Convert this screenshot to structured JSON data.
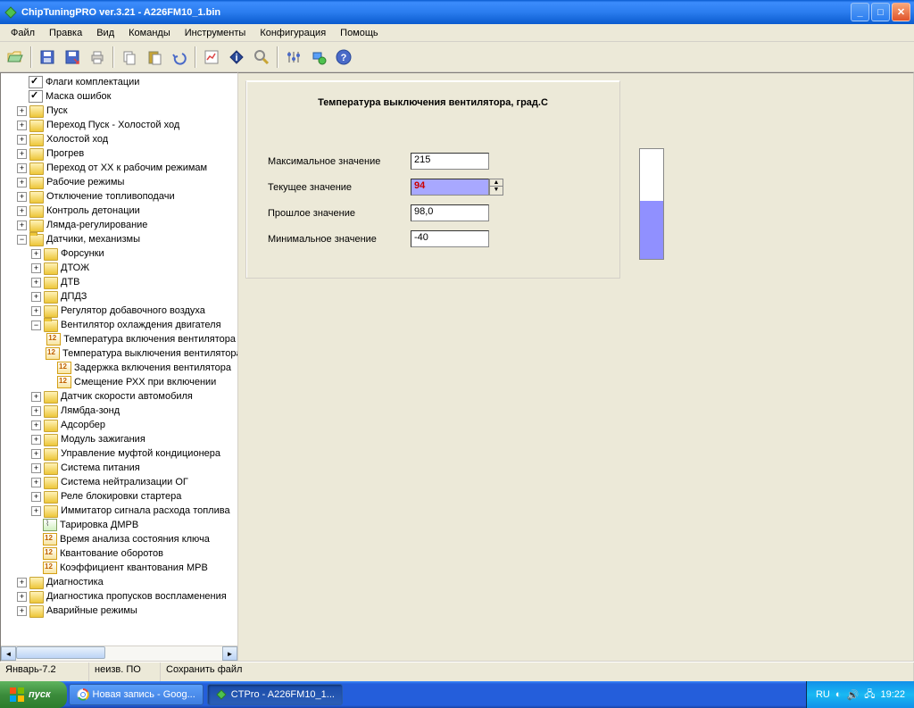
{
  "window": {
    "title": "ChipTuningPRO ver.3.21 - A226FM10_1.bin"
  },
  "menu": {
    "file": "Файл",
    "edit": "Правка",
    "view": "Вид",
    "cmds": "Команды",
    "tools": "Инструменты",
    "config": "Конфигурация",
    "help": "Помощь"
  },
  "tree": {
    "i0": "Флаги комплектации",
    "i1": "Маска ошибок",
    "i2": "Пуск",
    "i3": "Переход Пуск - Холостой ход",
    "i4": "Холостой ход",
    "i5": "Прогрев",
    "i6": "Переход от XX к рабочим режимам",
    "i7": "Рабочие режимы",
    "i8": "Отключение топливоподачи",
    "i9": "Контроль детонации",
    "i10": "Лямда-регулирование",
    "i11": "Датчики, механизмы",
    "i12": "Форсунки",
    "i13": "ДТОЖ",
    "i14": "ДТВ",
    "i15": "ДПДЗ",
    "i16": "Регулятор добавочного воздуха",
    "i17": "Вентилятор охлаждения двигателя",
    "i18": "Температура включения вентилятора",
    "i19": "Температура выключения вентилятора",
    "i20": "Задержка включения вентилятора",
    "i21": "Смещение РХХ при включении",
    "i22": "Датчик скорости автомобиля",
    "i23": "Лямбда-зонд",
    "i24": "Адсорбер",
    "i25": "Модуль зажигания",
    "i26": "Управление муфтой кондиционера",
    "i27": "Система питания",
    "i28": "Система нейтрализации ОГ",
    "i29": "Реле блокировки стартера",
    "i30": "Иммитатор сигнала расхода топлива",
    "i31": "Тарировка ДМРВ",
    "i32": "Время анализа состояния ключа",
    "i33": "Квантование оборотов",
    "i34": "Коэффициент квантования МРВ",
    "i35": "Диагностика",
    "i36": "Диагностика пропусков воспламенения",
    "i37": "Аварийные режимы"
  },
  "panel": {
    "title": "Температура выключения вентилятора, град.C",
    "max_label": "Максимальное значение",
    "max_val": "215",
    "cur_label": "Текущее значение",
    "cur_val": "94",
    "prev_label": "Прошлое значение",
    "prev_val": "98,0",
    "min_label": "Минимальное значение",
    "min_val": "-40",
    "gauge_pct": 53
  },
  "status": {
    "s0": "Январь-7.2",
    "s1": "неизв. ПО",
    "s2": "Сохранить файл"
  },
  "taskbar": {
    "start": "пуск",
    "t0": "Новая запись - Goog...",
    "t1": "CTPro - A226FM10_1...",
    "lang": "RU",
    "time": "19:22"
  }
}
